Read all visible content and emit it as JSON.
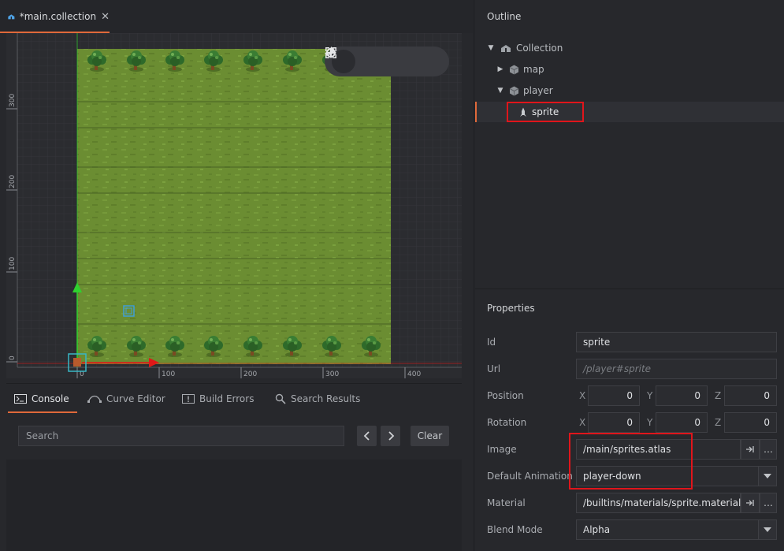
{
  "editor": {
    "tab_title": "*main.collection",
    "tab_close": "✕",
    "ruler_y": [
      "300",
      "200",
      "100",
      "0"
    ],
    "ruler_x": [
      "0",
      "100",
      "200",
      "300",
      "400"
    ],
    "tools": [
      "move-tool-icon",
      "rotate-tool-icon",
      "scale-tool-icon",
      "camera-reset-icon"
    ]
  },
  "console": {
    "tabs": [
      {
        "label": "Console"
      },
      {
        "label": "Curve Editor"
      },
      {
        "label": "Build Errors"
      },
      {
        "label": "Search Results"
      }
    ],
    "search_placeholder": "Search",
    "clear_label": "Clear"
  },
  "outline": {
    "title": "Outline",
    "items": [
      {
        "label": "Collection",
        "icon": "collection-icon"
      },
      {
        "label": "map",
        "icon": "game-object-icon"
      },
      {
        "label": "player",
        "icon": "game-object-icon"
      },
      {
        "label": "sprite",
        "icon": "sprite-icon"
      }
    ]
  },
  "properties": {
    "title": "Properties",
    "id_label": "Id",
    "id_value": "sprite",
    "url_label": "Url",
    "url_value": "/player#sprite",
    "position_label": "Position",
    "position": {
      "x": "0",
      "y": "0",
      "z": "0"
    },
    "rotation_label": "Rotation",
    "rotation": {
      "x": "0",
      "y": "0",
      "z": "0"
    },
    "axis_x": "X",
    "axis_y": "Y",
    "axis_z": "Z",
    "image_label": "Image",
    "image_value": "/main/sprites.atlas",
    "default_animation_label": "Default Animation",
    "default_animation_value": "player-down",
    "material_label": "Material",
    "material_value": "/builtins/materials/sprite.material",
    "blend_mode_label": "Blend Mode",
    "blend_mode_value": "Alpha",
    "more_label": "…"
  },
  "colors": {
    "accent": "#e0693a",
    "highlight": "#e0151b",
    "grass": "#6b8d32",
    "x_axis": "#e01818",
    "y_axis": "#2fd12f"
  }
}
